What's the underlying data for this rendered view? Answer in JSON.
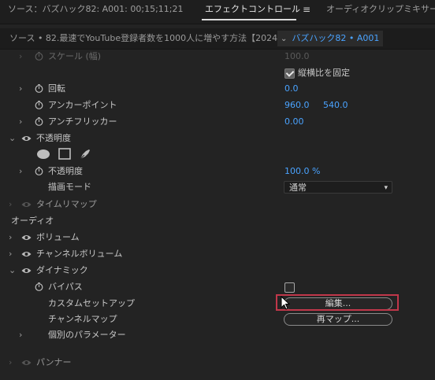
{
  "tabs": {
    "source": "ソース：バズハック82: A001: 00;15;11;21",
    "effect_controls": "エフェクトコントロール",
    "audio_mixer": "オーディオクリップミキサー：バ"
  },
  "header": {
    "source_name": "ソース • 82.最速でYouTube登録者数を1000人に増やす方法【2024...",
    "clip_name": "バズハック82 • A001"
  },
  "rows": {
    "scale_width": {
      "label": "スケール (幅)",
      "value": "100.0"
    },
    "uniform_scale": {
      "label": "縦横比を固定",
      "checked": true
    },
    "rotation": {
      "label": "回転",
      "value": "0.0"
    },
    "anchor_point": {
      "label": "アンカーポイント",
      "x": "960.0",
      "y": "540.0"
    },
    "anti_flicker": {
      "label": "アンチフリッカー",
      "value": "0.00"
    },
    "opacity_section": {
      "label": "不透明度"
    },
    "opacity": {
      "label": "不透明度",
      "value": "100.0 %"
    },
    "blend_mode": {
      "label": "描画モード",
      "value": "通常"
    },
    "time_remap": {
      "label": "タイムリマップ"
    },
    "audio_header": {
      "label": "オーディオ"
    },
    "volume": {
      "label": "ボリューム"
    },
    "channel_volume": {
      "label": "チャンネルボリューム"
    },
    "dynamics": {
      "label": "ダイナミック"
    },
    "bypass": {
      "label": "バイパス",
      "checked": false
    },
    "custom_setup": {
      "label": "カスタムセットアップ",
      "button": "編集..."
    },
    "channel_map": {
      "label": "チャンネルマップ",
      "button": "再マップ..."
    },
    "individual_params": {
      "label": "個別のパラメーター"
    },
    "panner": {
      "label": "パンナー"
    }
  },
  "colors": {
    "accent_value": "#4aa3ff",
    "highlight": "#c0374a"
  },
  "icons": {
    "menu": "hamburger-menu-icon",
    "stopwatch": "stopwatch-icon",
    "eye": "eye-icon",
    "ellipse_mask": "ellipse-mask-icon",
    "rect_mask": "rectangle-mask-icon",
    "pen_mask": "pen-mask-icon",
    "cursor": "mouse-pointer-icon"
  }
}
